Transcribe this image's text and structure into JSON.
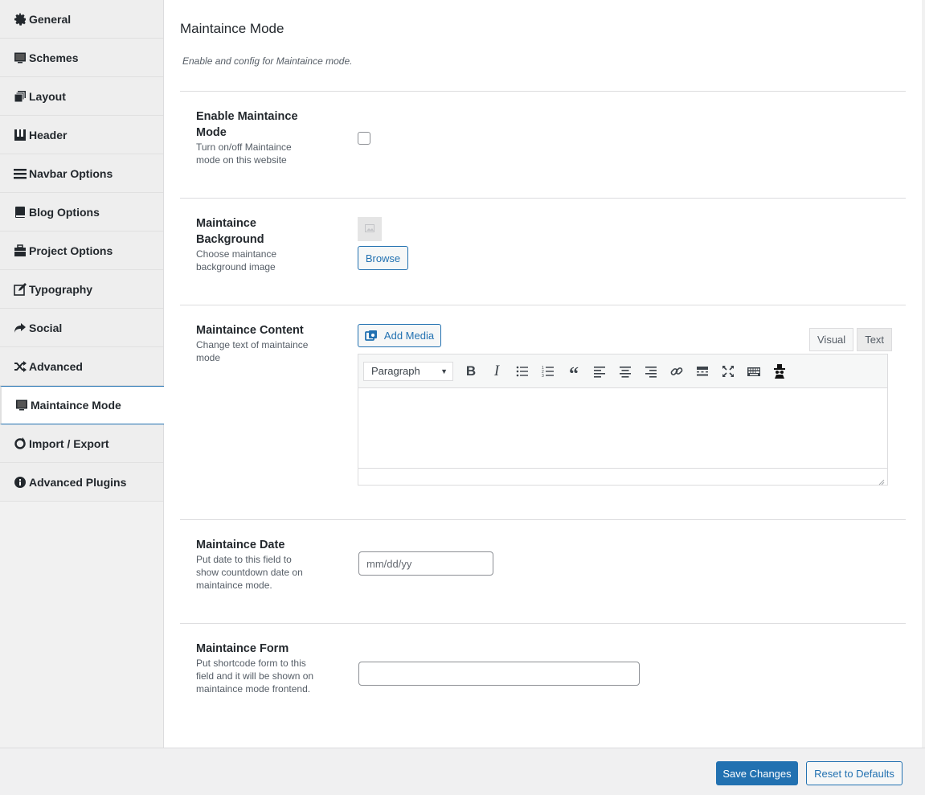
{
  "sidebar": {
    "items": [
      {
        "label": "General",
        "icon": "gear-icon"
      },
      {
        "label": "Schemes",
        "icon": "monitor-icon"
      },
      {
        "label": "Layout",
        "icon": "layers-icon"
      },
      {
        "label": "Header",
        "icon": "header-icon"
      },
      {
        "label": "Navbar Options",
        "icon": "menu-icon"
      },
      {
        "label": "Blog Options",
        "icon": "book-icon"
      },
      {
        "label": "Project Options",
        "icon": "briefcase-icon"
      },
      {
        "label": "Typography",
        "icon": "edit-icon"
      },
      {
        "label": "Social",
        "icon": "share-icon"
      },
      {
        "label": "Advanced",
        "icon": "shuffle-icon"
      },
      {
        "label": "Maintaince Mode",
        "icon": "monitor-icon",
        "active": true
      },
      {
        "label": "Import / Export",
        "icon": "refresh-icon"
      },
      {
        "label": "Advanced Plugins",
        "icon": "info-icon"
      }
    ]
  },
  "main": {
    "title": "Maintaince Mode",
    "description": "Enable and config for Maintaince mode.",
    "fields": {
      "enable": {
        "title": "Enable Maintaince Mode",
        "desc": "Turn on/off Maintaince mode on this website",
        "checked": false
      },
      "background": {
        "title": "Maintaince Background",
        "desc": "Choose maintance background image",
        "browse_label": "Browse"
      },
      "content": {
        "title": "Maintaince Content",
        "desc": "Change text of maintaince mode",
        "add_media_label": "Add Media",
        "tab_visual": "Visual",
        "tab_text": "Text",
        "format_value": "Paragraph"
      },
      "date": {
        "title": "Maintaince Date",
        "desc": "Put date to this field to show countdown date on maintaince mode.",
        "placeholder": "mm/dd/yy"
      },
      "form": {
        "title": "Maintaince Form",
        "desc": "Put shortcode form to this field and it will be shown on maintaince mode frontend.",
        "value": ""
      }
    }
  },
  "footer": {
    "save_label": "Save Changes",
    "reset_label": "Reset to Defaults"
  },
  "colors": {
    "accent": "#2271b1",
    "sidebar_bg": "#eeeeee",
    "footer_bg": "#f0f0f1"
  }
}
